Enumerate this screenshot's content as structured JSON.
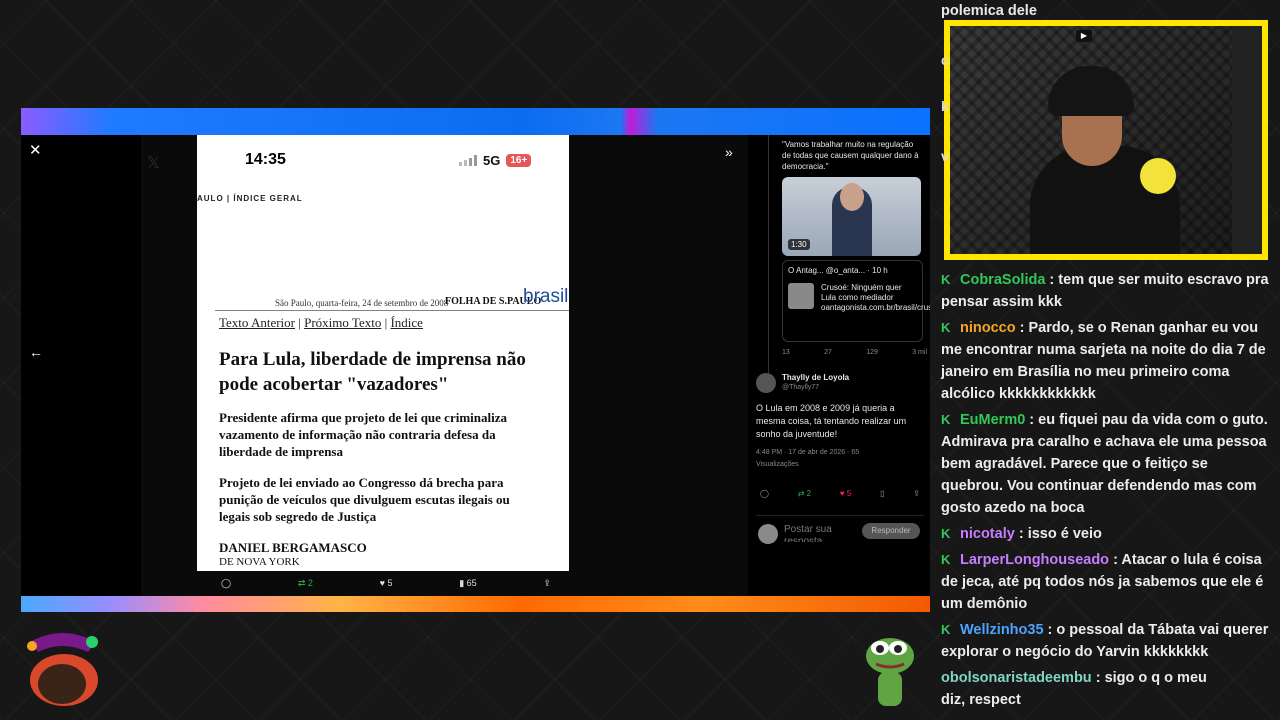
{
  "viewer": {
    "phone_time": "14:35",
    "network": "5G",
    "battery": "16+",
    "index_header": "AULO | ÍNDICE GERAL",
    "dateline": "São Paulo, quarta-feira, 24 de setembro de 2008",
    "masthead": "FOLHA DE S.PAULO",
    "section": "brasil",
    "nav_prev": "Texto Anterior",
    "nav_next": "Próximo Texto",
    "nav_index": "Índice",
    "headline": "Para Lula, liberdade de imprensa não pode acobertar \"vazadores\"",
    "sub1": "Presidente afirma que projeto de lei que criminaliza vazamento de informação não contraria defesa da liberdade de imprensa",
    "sub2": "Projeto de lei enviado ao Congresso dá brecha para punição de veículos que divulguem escutas ilegais ou legais sob segredo de Justiça",
    "byline": "DANIEL BERGAMASCO",
    "place": "DE NOVA YORK",
    "actions": {
      "retweets": "2",
      "likes": "5",
      "views": "65"
    }
  },
  "tweet": {
    "quote": "\"Vamos trabalhar muito na regulação de todas que causem qualquer dano à democracia.\"",
    "video_duration": "1:30",
    "quoted_header": "O Antag... @o_anta... · 10 h",
    "quoted_text": "Crusoé: Ninguém quer Lula como mediador oantagonista.com.br/brasil/crusoe-...",
    "quoted_stats": [
      "13",
      "27",
      "129",
      "3 mil"
    ],
    "author_name": "Thaylly de Loyola",
    "author_handle": "@Thaylly77",
    "text": "O Lula em 2008 e 2009 já queria a mesma coisa, tá tentando realizar um sonho da juventude!",
    "meta": "4:48 PM · 17 de abr de 2026 · 65",
    "views_label": "Visualizações",
    "retweets": "2",
    "likes": "5",
    "reply_placeholder": "Postar sua resposta",
    "reply_button": "Responder"
  },
  "chat": {
    "top_cut": "polemica dele",
    "messages": [
      {
        "user": "CobraSolida",
        "color": "#34c759",
        "text": "tem que ser muito escravo pra pensar assim kkk"
      },
      {
        "user": "ninocco",
        "color": "#f5a623",
        "text": "Pardo, se o Renan ganhar eu vou me encontrar numa sarjeta na noite do dia 7 de janeiro em Brasília no meu primeiro coma alcólico kkkkkkkkkkkk"
      },
      {
        "user": "EuMerm0",
        "color": "#34c759",
        "text": "eu fiquei pau da vida com o guto. Admirava pra caralho e achava ele uma pessoa bem agradável. Parece que o feitiço se quebrou. Vou continuar defendendo mas com gosto azedo na boca"
      },
      {
        "user": "nicotaly",
        "color": "#c77dff",
        "text": "isso é veio"
      },
      {
        "user": "LarperLonghouseado",
        "color": "#c77dff",
        "text": "Atacar o lula é coisa de jeca, até pq todos nós ja sabemos que ele é um demônio"
      },
      {
        "user": "Wellzinho35",
        "color": "#4ea3ff",
        "text": "o pessoal da Tábata vai querer explorar o negócio do Yarvin kkkkkkkk"
      },
      {
        "user": "obolsonaristadeembu",
        "color": "#7fd6c2",
        "text": "sigo o q o meu"
      }
    ],
    "last_line": "diz, respect"
  },
  "colors": {
    "accent_green": "#34c759",
    "cam_border": "#ffe600"
  },
  "icons": [
    "close-icon",
    "arrow-left-icon",
    "expand-icon",
    "reply-icon",
    "retweet-icon",
    "heart-icon",
    "views-icon",
    "share-icon",
    "bookmark-icon"
  ]
}
